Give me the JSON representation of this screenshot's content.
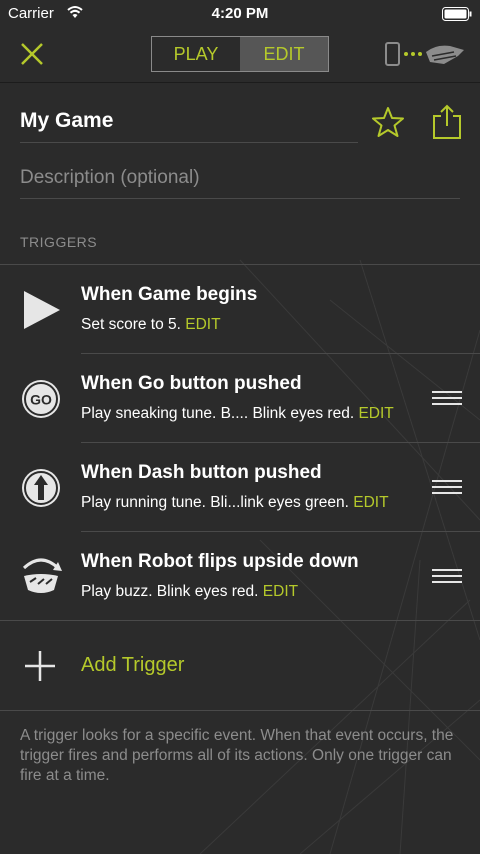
{
  "status_bar": {
    "carrier": "Carrier",
    "time": "4:20 PM"
  },
  "nav": {
    "tabs": [
      {
        "label": "PLAY",
        "active": false
      },
      {
        "label": "EDIT",
        "active": true
      }
    ],
    "icons": {
      "close": "close-icon",
      "robot_connection": "robot-connection-icon"
    }
  },
  "game": {
    "title_value": "My Game",
    "description_placeholder": "Description (optional)"
  },
  "triggers_section": {
    "header": "TRIGGERS",
    "items": [
      {
        "icon": "play-triangle-icon",
        "title": "When Game begins",
        "description": "Set score to 5. ",
        "edit_label": "EDIT",
        "draggable": false
      },
      {
        "icon": "go-button-icon",
        "title": "When Go button pushed",
        "description": "Play sneaking tune. B.... Blink eyes red. ",
        "edit_label": "EDIT",
        "draggable": true
      },
      {
        "icon": "dash-button-icon",
        "title": "When Dash button pushed",
        "description": "Play running tune. Bli...link eyes green. ",
        "edit_label": "EDIT",
        "draggable": true
      },
      {
        "icon": "robot-flip-icon",
        "title": "When Robot flips upside down",
        "description": "Play buzz. Blink eyes red. ",
        "edit_label": "EDIT",
        "draggable": true
      }
    ],
    "add_label": "Add Trigger"
  },
  "footer_note": "A trigger looks for a specific event. When that event occurs, the trigger fires and performs all of its actions. Only one trigger can fire at a time.",
  "colors": {
    "accent": "#b5c92b",
    "background": "#2b2b2b",
    "muted_text": "#8c8c8c",
    "divider": "#4a4a4a"
  }
}
